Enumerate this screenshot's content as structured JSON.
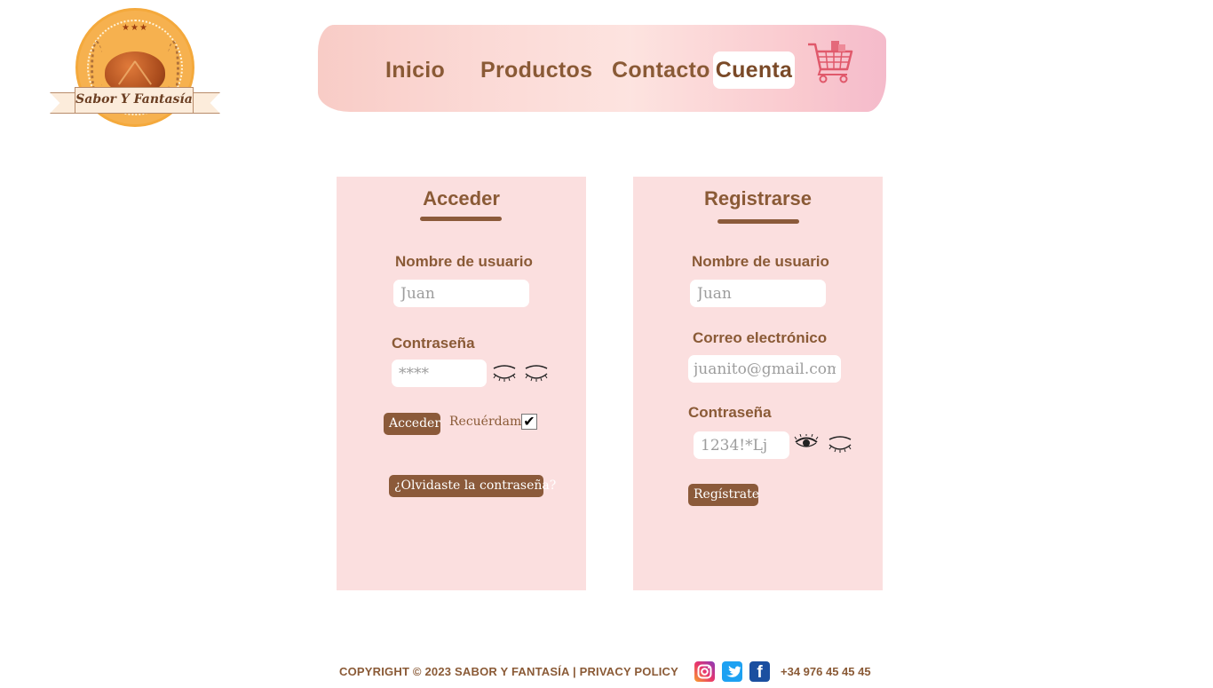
{
  "brand": {
    "logo_text": "Sabor Y Fantasía",
    "logo_stars": "★★★"
  },
  "nav": {
    "items": [
      {
        "label": "Inicio"
      },
      {
        "label": "Productos"
      },
      {
        "label": "Contacto"
      },
      {
        "label": "Cuenta",
        "active": true
      }
    ],
    "cart_icon": "shopping-cart-icon"
  },
  "login": {
    "title": "Acceder",
    "username_label": "Nombre de usuario",
    "username_placeholder": "Juan",
    "password_label": "Contraseña",
    "password_placeholder": "****",
    "password_icons": [
      "eye-closed-icon",
      "eye-closed-icon"
    ],
    "submit_label": "Acceder",
    "remember_label": "Recuérdame",
    "remember_checked": true,
    "forgot_label": "¿Olvidaste la contraseña?"
  },
  "register": {
    "title": "Registrarse",
    "username_label": "Nombre de usuario",
    "username_placeholder": "Juan",
    "email_label": "Correo electrónico",
    "email_placeholder": "juanito@gmail.com",
    "password_label": "Contraseña",
    "password_placeholder": "1234!*Lj",
    "password_icons": [
      "eye-open-icon",
      "eye-closed-icon"
    ],
    "submit_label": "Regístrate"
  },
  "footer": {
    "copyright": "COPYRIGHT © 2023 SABOR Y FANTASÍA | PRIVACY POLICY",
    "social": [
      "instagram-icon",
      "twitter-icon",
      "facebook-icon"
    ],
    "phone": "+34 976 45 45 45"
  },
  "colors": {
    "brown": "#8a5a36",
    "panel_pink": "#fbdfdf",
    "nav_pink": "#f9c6cc",
    "logo_orange": "#f6b14f"
  }
}
